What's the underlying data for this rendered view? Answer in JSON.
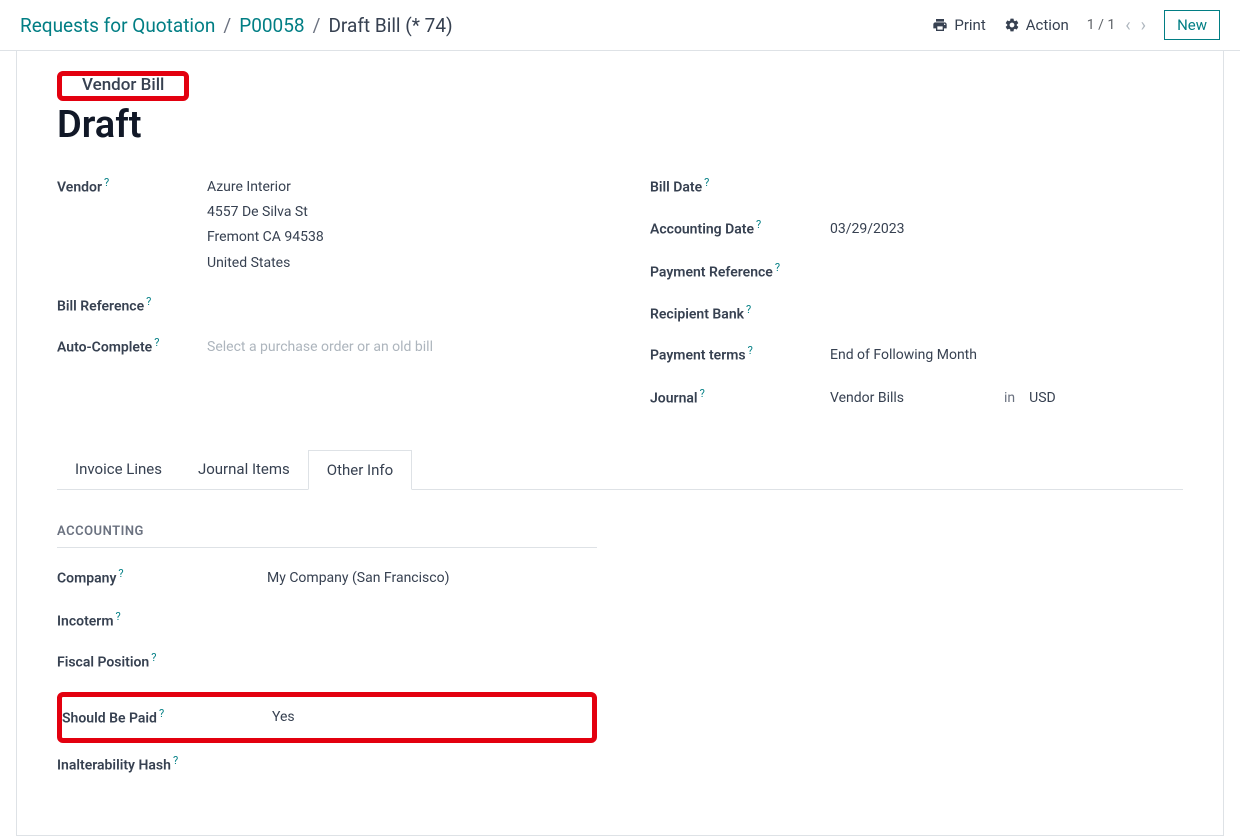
{
  "breadcrumb": {
    "root": "Requests for Quotation",
    "po": "P00058",
    "current": "Draft Bill (* 74)"
  },
  "header": {
    "print": "Print",
    "action": "Action",
    "pager": "1 / 1",
    "new": "New"
  },
  "badge": "Vendor Bill",
  "title": "Draft",
  "left": {
    "vendor_label": "Vendor",
    "vendor_name": "Azure Interior",
    "vendor_street": "4557 De Silva St",
    "vendor_city": "Fremont CA 94538",
    "vendor_country": "United States",
    "billref_label": "Bill Reference",
    "auto_label": "Auto-Complete",
    "auto_placeholder": "Select a purchase order or an old bill"
  },
  "right": {
    "billdate_label": "Bill Date",
    "acctdate_label": "Accounting Date",
    "acctdate_value": "03/29/2023",
    "payref_label": "Payment Reference",
    "bank_label": "Recipient Bank",
    "terms_label": "Payment terms",
    "terms_value": "End of Following Month",
    "journal_label": "Journal",
    "journal_value": "Vendor Bills",
    "journal_in": "in",
    "journal_currency": "USD"
  },
  "tabs": {
    "invoice": "Invoice Lines",
    "journal": "Journal Items",
    "other": "Other Info"
  },
  "section": "ACCOUNTING",
  "acct": {
    "company_label": "Company",
    "company_value": "My Company (San Francisco)",
    "incoterm_label": "Incoterm",
    "fiscal_label": "Fiscal Position",
    "paid_label": "Should Be Paid",
    "paid_value": "Yes",
    "hash_label": "Inalterability Hash"
  }
}
